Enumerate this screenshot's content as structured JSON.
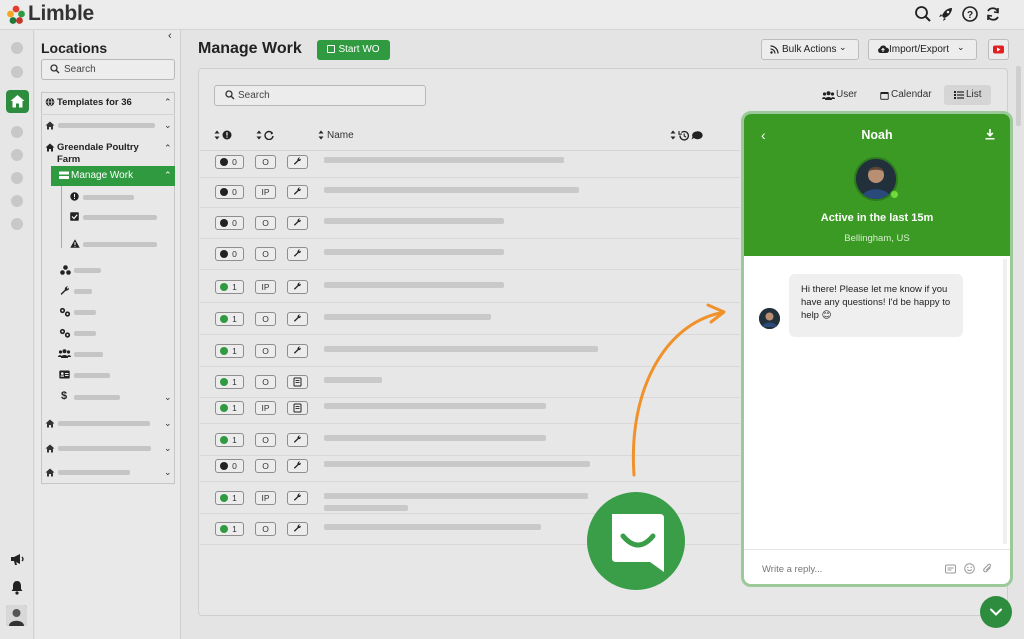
{
  "app": {
    "name": "Limble"
  },
  "locations": {
    "title": "Locations",
    "search_placeholder": "Search",
    "templates_label": "Templates for 36",
    "farm_label": "Greendale Poultry Farm",
    "manage_work_label": "Manage Work"
  },
  "main": {
    "title": "Manage Work",
    "start_wo": "Start WO",
    "bulk_actions": "Bulk Actions",
    "import_export": "Import/Export",
    "search_placeholder": "Search",
    "views": {
      "user": "User",
      "calendar": "Calendar",
      "list": "List"
    },
    "col_name": "Name",
    "rows": [
      {
        "count": "0",
        "state": "black",
        "status": "O",
        "type": "wrench",
        "bar": 240
      },
      {
        "count": "0",
        "state": "black",
        "status": "IP",
        "type": "wrench",
        "bar": 255
      },
      {
        "count": "0",
        "state": "black",
        "status": "O",
        "type": "wrench",
        "bar": 180
      },
      {
        "count": "0",
        "state": "black",
        "status": "O",
        "type": "wrench",
        "bar": 180
      },
      {
        "count": "1",
        "state": "green",
        "status": "IP",
        "type": "wrench",
        "bar": 180
      },
      {
        "count": "1",
        "state": "green",
        "status": "O",
        "type": "wrench",
        "bar": 167
      },
      {
        "count": "1",
        "state": "green",
        "status": "O",
        "type": "wrench",
        "bar": 274
      },
      {
        "count": "1",
        "state": "green",
        "status": "O",
        "type": "doc",
        "bar": 58
      },
      {
        "count": "1",
        "state": "green",
        "status": "IP",
        "type": "doc",
        "bar": 222
      },
      {
        "count": "1",
        "state": "green",
        "status": "O",
        "type": "wrench",
        "bar": 222
      },
      {
        "count": "0",
        "state": "black",
        "status": "O",
        "type": "wrench",
        "bar": 266
      },
      {
        "count": "1",
        "state": "green",
        "status": "IP",
        "type": "wrench",
        "bar": 264
      },
      {
        "count": "1",
        "state": "green",
        "status": "O",
        "type": "wrench",
        "bar": 217
      }
    ]
  },
  "chat": {
    "agent_name": "Noah",
    "status": "Active in the last 15m",
    "location": "Bellingham, US",
    "message": "Hi there!  Please let me know if you have any questions!  I'd be happy to help 😊",
    "reply_placeholder": "Write a reply..."
  },
  "colors": {
    "brand_green": "#2f9a40",
    "chat_green": "#3a9a23",
    "arrow_orange": "#f0922b"
  }
}
